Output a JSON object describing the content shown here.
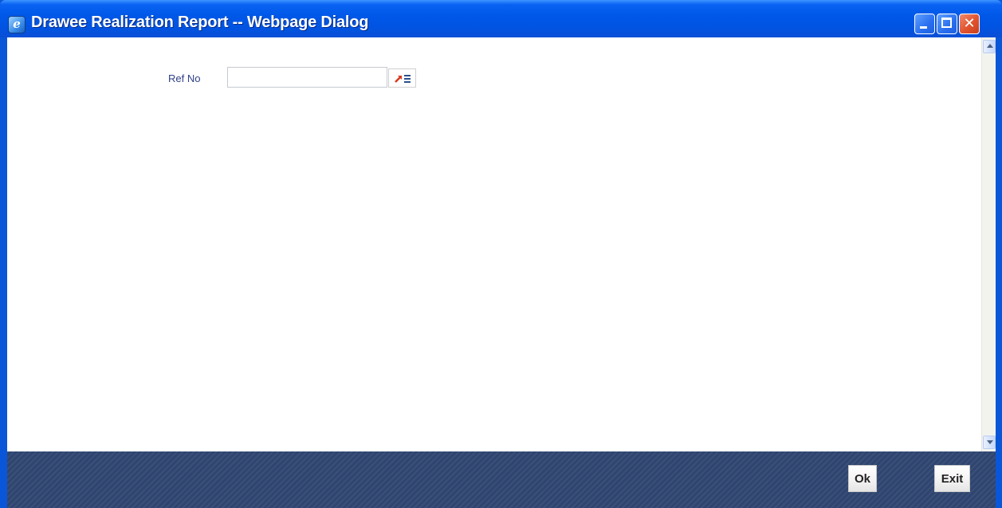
{
  "window": {
    "title": "Drawee Realization Report -- Webpage Dialog",
    "icon": "ie-icon",
    "controls": [
      "minimize",
      "maximize",
      "close"
    ]
  },
  "form": {
    "ref_no": {
      "label": "Ref No",
      "value": "",
      "lov_icon": "list-of-values-icon"
    }
  },
  "footer": {
    "ok_label": "Ok",
    "exit_label": "Exit"
  },
  "colors": {
    "titlebar": "#0054e3",
    "footer": "#2f4570",
    "label": "#31418a"
  }
}
